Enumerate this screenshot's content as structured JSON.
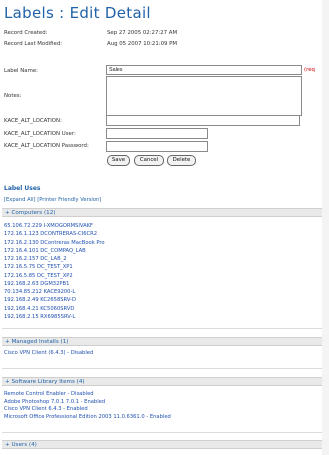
{
  "title": "Labels : Edit Detail",
  "record": {
    "created_label": "Record Created:",
    "created_value": "Sep 27 2005 02:27:27 AM",
    "modified_label": "Record Last Modified:",
    "modified_value": "Aug 05 2007 10:21:09 PM"
  },
  "form": {
    "label_name_label": "Label Name:",
    "label_name_value": "Sales",
    "required_note": "(req",
    "notes_label": "Notes:",
    "notes_value": "",
    "alt_location_label": "KACE_ALT_LOCATION:",
    "alt_location_value": "",
    "alt_user_label": "KACE_ALT_LOCATION User:",
    "alt_user_value": "",
    "alt_password_label": "KACE_ALT_LOCATION Password:",
    "alt_password_value": ""
  },
  "buttons": {
    "save": "Save",
    "cancel": "Cancel",
    "delete": "Delete"
  },
  "uses": {
    "title": "Label Uses",
    "expand_all": "[Expand All]",
    "printer_friendly": "[Printer Friendly Version]"
  },
  "sections": {
    "computers": "+ Computers (12)",
    "managed_installs": "+ Managed Installs (1)",
    "software_library": "+ Software Library Items (4)",
    "users": "+ Users (4)"
  },
  "computers": [
    "65.106.72.229 I-XMOGORMSIVAKF",
    "172.16.1.123 DCONTRERAS-CI6CR2",
    "172.16.2.130 DContreras MacBook Pro",
    "172.16.4.101 DC_COMPAQ_LAB",
    "172.16.2.157 DC_LAB_2",
    "172.16.5.75 DC_TEST_XP1",
    "172.16.5.85 DC_TEST_XP2",
    "192.168.2.63 DGM32PB1",
    "70.134.85.212 KACE9200-L",
    "192.168.2.49 KC2658SRV-D",
    "192.168.4.21 KC5060SRVD",
    "192.168.2.15 RX6985SRV-L"
  ],
  "managed_installs": [
    "Cisco VPN Client (6.4.3) - Disabled"
  ],
  "software_library": [
    "Remote Control Enabler - Disabled",
    "Adobe Photoshop 7.0.1 7.0.1 - Enabled",
    "Cisco VPN Client 6.4.3 - Enabled",
    "Microsoft Office Professional Edition 2003 11.0.6361.0 - Enabled"
  ]
}
